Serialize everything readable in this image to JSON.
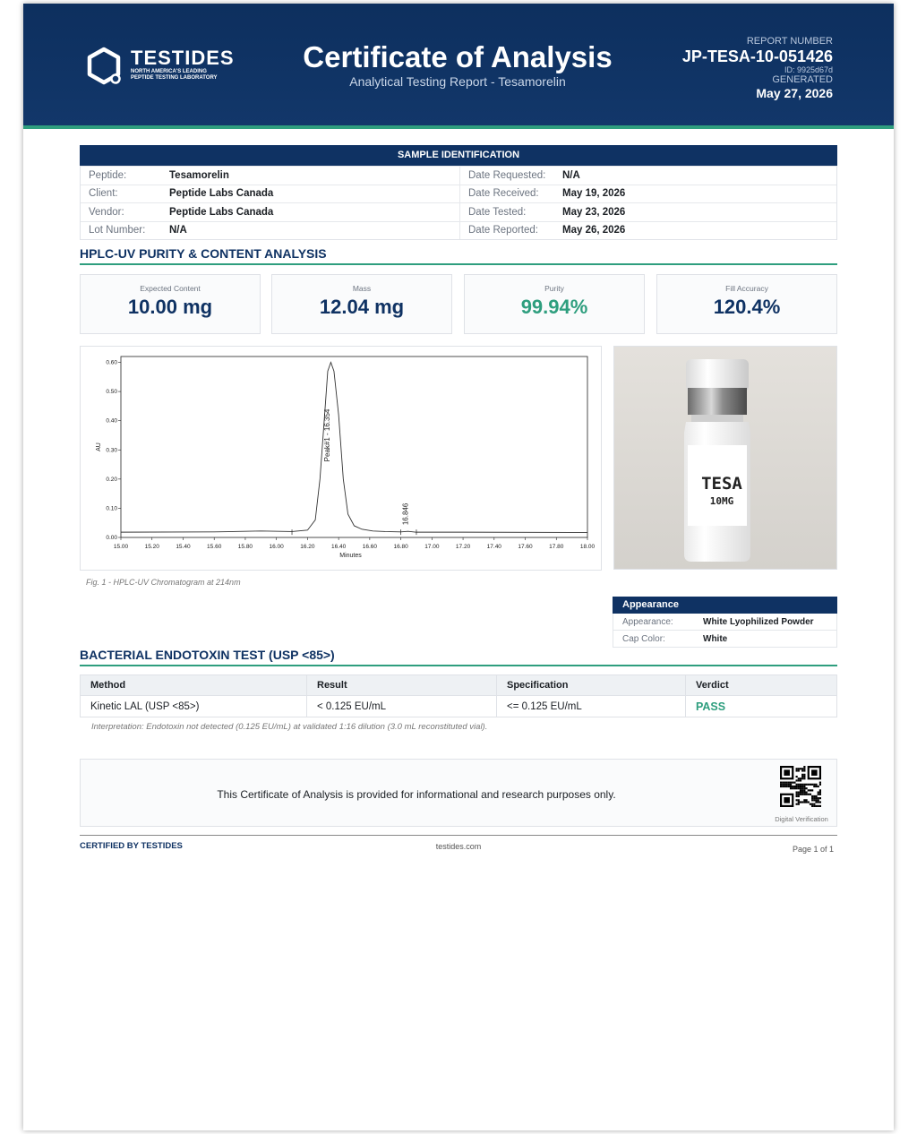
{
  "header": {
    "brand_name": "TESTIDES",
    "brand_tagline_1": "NORTH AMERICA'S LEADING",
    "brand_tagline_2": "PEPTIDE TESTING LABORATORY",
    "title": "Certificate of Analysis",
    "subtitle": "Analytical Testing Report  -  Tesamorelin",
    "report_number_label": "REPORT NUMBER",
    "report_number": "JP-TESA-10-051426",
    "report_id": "ID: 9925d67d",
    "generated_label": "GENERATED",
    "generated_date": "May 27, 2026"
  },
  "sample": {
    "section_title": "SAMPLE IDENTIFICATION",
    "rows": [
      {
        "k1": "Peptide:",
        "v1": "Tesamorelin",
        "k2": "Date Requested:",
        "v2": "N/A"
      },
      {
        "k1": "Client:",
        "v1": "Peptide Labs Canada",
        "k2": "Date Received:",
        "v2": "May 19, 2026"
      },
      {
        "k1": "Vendor:",
        "v1": "Peptide Labs Canada",
        "k2": "Date Tested:",
        "v2": "May 23, 2026"
      },
      {
        "k1": "Lot Number:",
        "v1": "N/A",
        "k2": "Date Reported:",
        "v2": "May 26, 2026"
      }
    ]
  },
  "hplc": {
    "section_title": "HPLC-UV PURITY & CONTENT ANALYSIS",
    "cards": [
      {
        "label": "Expected Content",
        "value": "10.00 mg"
      },
      {
        "label": "Mass",
        "value": "12.04 mg"
      },
      {
        "label": "Purity",
        "value": "99.94%"
      },
      {
        "label": "Fill Accuracy",
        "value": "120.4%"
      }
    ],
    "figure_caption": "Fig. 1  -  HPLC-UV Chromatogram at 214nm"
  },
  "chart_data": {
    "type": "line",
    "title": "",
    "xlabel": "Minutes",
    "ylabel": "AU",
    "xlim": [
      15.0,
      18.0
    ],
    "ylim": [
      0.0,
      0.62
    ],
    "x_ticks": [
      "15.00",
      "15.20",
      "15.40",
      "15.60",
      "15.80",
      "16.00",
      "16.20",
      "16.40",
      "16.60",
      "16.80",
      "17.00",
      "17.20",
      "17.40",
      "17.60",
      "17.80",
      "18.00"
    ],
    "y_ticks": [
      "0.00",
      "0.10",
      "0.20",
      "0.30",
      "0.40",
      "0.50",
      "0.60"
    ],
    "series": [
      {
        "name": "",
        "x": [
          15.0,
          15.6,
          15.9,
          16.1,
          16.2,
          16.25,
          16.28,
          16.31,
          16.33,
          16.35,
          16.37,
          16.4,
          16.43,
          16.46,
          16.5,
          16.55,
          16.62,
          16.7,
          16.8,
          16.846,
          16.9,
          17.2,
          18.0
        ],
        "y": [
          0.018,
          0.019,
          0.022,
          0.02,
          0.025,
          0.06,
          0.2,
          0.42,
          0.57,
          0.6,
          0.57,
          0.42,
          0.2,
          0.08,
          0.04,
          0.028,
          0.022,
          0.02,
          0.019,
          0.021,
          0.018,
          0.018,
          0.017
        ]
      }
    ],
    "peak_labels": [
      "Peak#1 - 16.354",
      "16.846"
    ],
    "peaks_x": [
      16.354,
      16.846
    ]
  },
  "appearance": {
    "title": "Appearance",
    "rows": [
      {
        "k": "Appearance:",
        "v": "White Lyophilized Powder"
      },
      {
        "k": "Cap Color:",
        "v": "White"
      }
    ]
  },
  "vial_label": {
    "line1": "TESA",
    "line2": "10MG"
  },
  "endotoxin": {
    "section_title": "BACTERIAL ENDOTOXIN TEST (USP <85>)",
    "headers": [
      "Method",
      "Result",
      "Specification",
      "Verdict"
    ],
    "row": [
      "Kinetic LAL (USP <85>)",
      "< 0.125 EU/mL",
      "<= 0.125 EU/mL",
      "PASS"
    ],
    "interpretation": "Interpretation: Endotoxin not detected (0.125 EU/mL) at validated 1:16 dilution (3.0 mL reconstituted vial)."
  },
  "note": {
    "text": "This Certificate of Analysis is provided for informational and research purposes only.",
    "qr_caption": "Digital Verification"
  },
  "footer": {
    "certified": "CERTIFIED BY TESTIDES",
    "website": "testides.com",
    "page": "Page 1 of 1"
  },
  "colors": {
    "navy": "#0f3263",
    "green": "#2e9e7e"
  }
}
